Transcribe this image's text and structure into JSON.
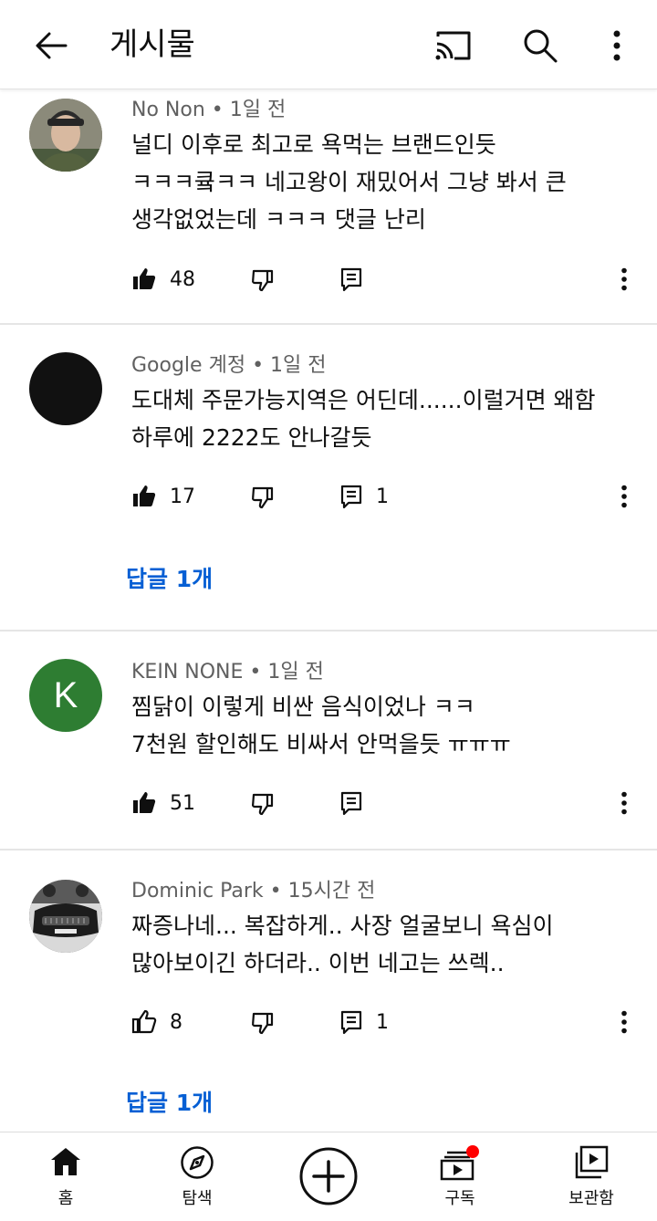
{
  "header": {
    "title": "게시물",
    "back_icon": "arrow-left-icon",
    "cast_icon": "cast-icon",
    "search_icon": "search-icon",
    "more_icon": "more-vert-icon"
  },
  "comments": [
    {
      "author": "No Non",
      "time": "1일 전",
      "text": "널디 이후로 최고로 욕먹는 브랜드인듯\nㅋㅋㅋ큨ㅋㅋ 네고왕이 재밌어서 그냥 봐서 큰\n생각없었는데 ㅋㅋㅋ 댓글 난리",
      "likes": "48",
      "reply_count": "",
      "liked": true,
      "avatar": "photo-soldier"
    },
    {
      "author": "Google 계정",
      "time": "1일 전",
      "text": "도대체 주문가능지역은 어딘데......이럴거면 왜함\n하루에 2222도 안나갈듯",
      "likes": "17",
      "reply_count": "1",
      "liked": true,
      "avatar": "black-circle",
      "replies_label": "답글 1개"
    },
    {
      "author": "KEIN NONE",
      "time": "1일 전",
      "text": "찜닭이 이렇게 비싼 음식이었나 ㅋㅋ\n7천원 할인해도 비싸서 안먹을듯 ㅠㅠㅠ",
      "likes": "51",
      "reply_count": "",
      "liked": true,
      "avatar": "letter-K",
      "avatar_letter": "K",
      "avatar_color": "#2e7d32"
    },
    {
      "author": "Dominic Park",
      "time": "15시간 전",
      "text": "짜증나네... 복잡하게.. 사장 얼굴보니 욕심이\n많아보이긴 하더라.. 이번 네고는 쓰렉..",
      "likes": "8",
      "reply_count": "1",
      "liked": false,
      "avatar": "photo-car",
      "replies_label": "답글 1개"
    }
  ],
  "separator": "•",
  "nav": {
    "home": "홈",
    "explore": "탐색",
    "create": "",
    "subscriptions": "구독",
    "library": "보관함"
  },
  "colors": {
    "link": "#065fd4",
    "notification_dot": "#ff0000"
  }
}
